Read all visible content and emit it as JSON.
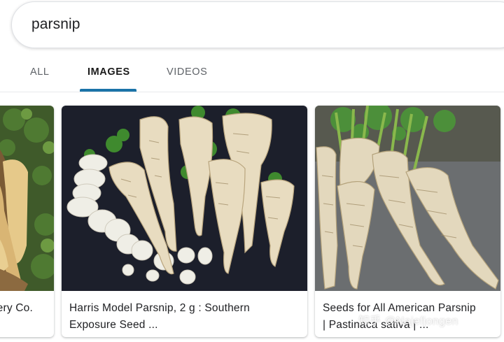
{
  "search": {
    "query": "parsnip"
  },
  "tabs": [
    {
      "label": "ALL",
      "active": false
    },
    {
      "label": "IMAGES",
      "active": true
    },
    {
      "label": "VIDEOS",
      "active": false
    }
  ],
  "colors": {
    "accent": "#1a73a8",
    "text": "#202124",
    "muted": "#5f6368"
  },
  "results": [
    {
      "caption_line1": "",
      "caption_line2": "ery Co."
    },
    {
      "caption_line1": "Harris Model Parsnip, 2 g : Southern",
      "caption_line2": "Exposure Seed ..."
    },
    {
      "caption_line1": "Seeds for All American Parsnip",
      "caption_line2": "| Pastinaca sativa | ..."
    }
  ],
  "watermark": "知乎 @Najefjongen"
}
